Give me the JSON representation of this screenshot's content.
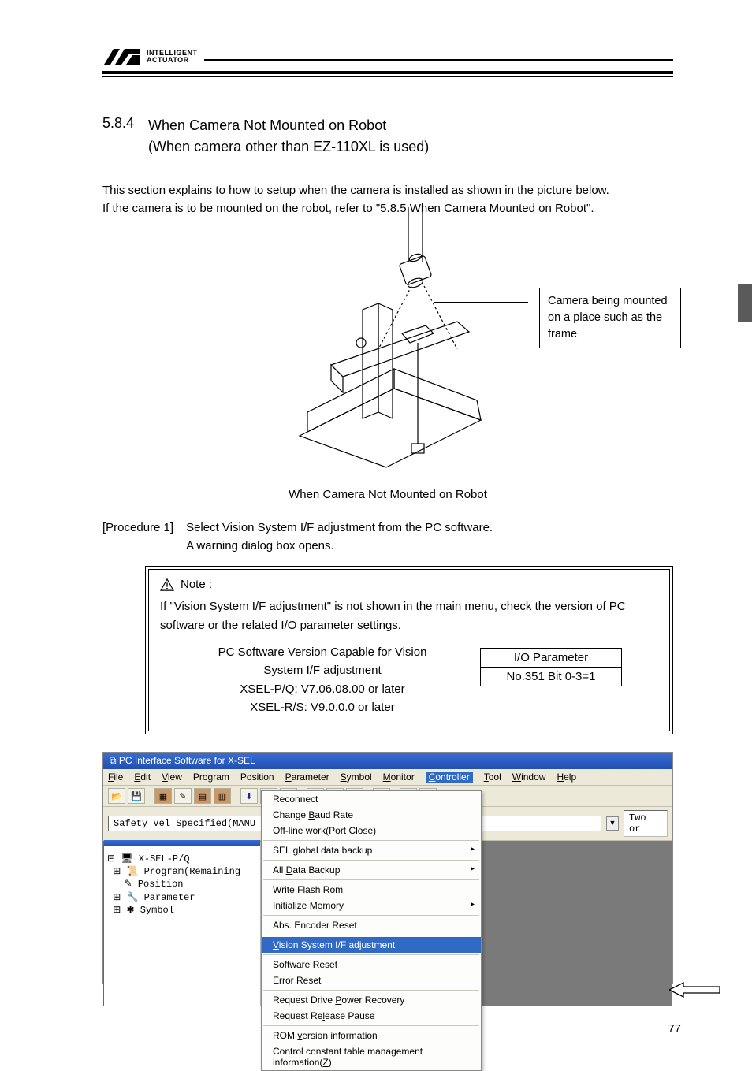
{
  "header": {
    "brand_line1": "INTELLIGENT",
    "brand_line2": "ACTUATOR"
  },
  "section": {
    "number": "5.8.4",
    "title_line1": "When Camera Not Mounted on Robot",
    "title_line2": "(When camera other than EZ-110XL is used)"
  },
  "intro": {
    "p1": "This section explains to how to setup when the camera is installed as shown in the picture below.",
    "p2": "If the camera is to be mounted on the robot, refer to \"5.8.5 When Camera Mounted on Robot\"."
  },
  "figure": {
    "callout": "Camera being mounted on a place such as the frame",
    "caption": "When Camera Not Mounted on Robot"
  },
  "procedure": {
    "label": "[Procedure 1]",
    "line1": "Select Vision System I/F adjustment from the PC software.",
    "line2": "A warning dialog box opens."
  },
  "note": {
    "title": "Note :",
    "body": "If \"Vision System I/F adjustment\" is not shown in the main menu, check the version of PC software or the related I/O parameter settings.",
    "left_h1": "PC Software Version Capable for Vision",
    "left_h2": "System I/F adjustment",
    "left_l1": "XSEL-P/Q: V7.06.08.00 or later",
    "left_l2": "XSEL-R/S: V9.0.0.0 or later",
    "io_h": "I/O Parameter",
    "io_v": "No.351 Bit 0-3=1"
  },
  "screenshot": {
    "title": "PC Interface Software for X-SEL",
    "menu": [
      "File",
      "Edit",
      "View",
      "Program",
      "Position",
      "Parameter",
      "Symbol",
      "Monitor",
      "Controller",
      "Tool",
      "Window",
      "Help"
    ],
    "menu_underlines": [
      "F",
      "E",
      "V",
      "",
      "",
      "P",
      "S",
      "M",
      "C",
      "T",
      "W",
      "H"
    ],
    "status_left": "Safety Vel Specified(MANU Mode)",
    "status_right": "Two or",
    "tree": {
      "root": "X-SEL-P/Q",
      "items": [
        "Program(Remaining",
        "Position",
        "Parameter",
        "Symbol"
      ]
    },
    "context_menu": [
      {
        "label": "Reconnect",
        "u": ""
      },
      {
        "label": "Change Baud Rate",
        "u": "B"
      },
      {
        "label": "Off-line work(Port Close)",
        "u": "O"
      },
      {
        "sep": true
      },
      {
        "label": "SEL global data backup",
        "u": "g",
        "arrow": true
      },
      {
        "sep": true
      },
      {
        "label": "All Data Backup",
        "u": "D",
        "arrow": true
      },
      {
        "sep": true
      },
      {
        "label": "Write Flash Rom",
        "u": "W"
      },
      {
        "label": "Initialize Memory",
        "u": "",
        "arrow": true
      },
      {
        "sep": true
      },
      {
        "label": "Abs. Encoder Reset",
        "u": ""
      },
      {
        "sep": true
      },
      {
        "label": "Vision System I/F adjustment",
        "u": "V",
        "hl": true
      },
      {
        "sep": true
      },
      {
        "label": "Software Reset",
        "u": "R"
      },
      {
        "label": "Error Reset",
        "u": ""
      },
      {
        "sep": true
      },
      {
        "label": "Request Drive Power Recovery",
        "u": "P"
      },
      {
        "label": "Request Release Pause",
        "u": "l"
      },
      {
        "sep": true
      },
      {
        "label": "ROM version information",
        "u": "v"
      },
      {
        "label": "Control constant table management information(Z)",
        "u": "Z"
      }
    ]
  },
  "page_number": "77"
}
